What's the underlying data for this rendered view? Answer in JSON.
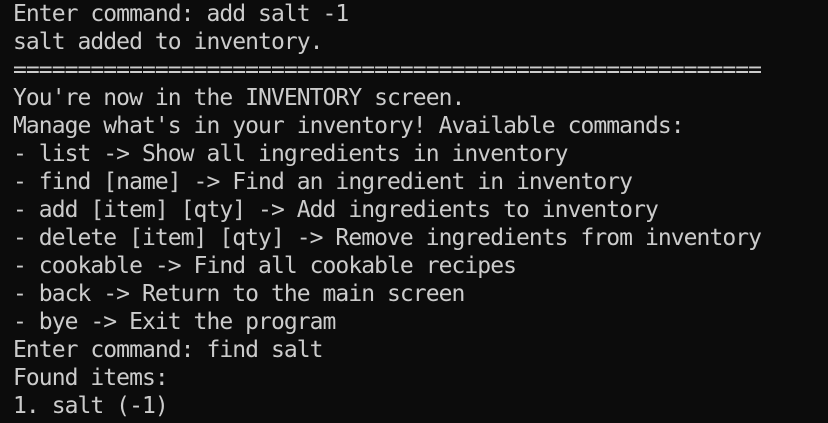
{
  "terminal": {
    "lines": [
      "Enter command: add salt -1",
      "salt added to inventory.",
      "==========================================================",
      "You're now in the INVENTORY screen.",
      "Manage what's in your inventory! Available commands:",
      "- list -> Show all ingredients in inventory",
      "- find [name] -> Find an ingredient in inventory",
      "- add [item] [qty] -> Add ingredients to inventory",
      "- delete [item] [qty] -> Remove ingredients from inventory",
      "- cookable -> Find all cookable recipes",
      "- back -> Return to the main screen",
      "- bye -> Exit the program",
      "Enter command: find salt",
      "Found items:",
      "1. salt (-1)"
    ],
    "colors": {
      "background": "#0c0c0c",
      "foreground": "#cccccc"
    }
  }
}
